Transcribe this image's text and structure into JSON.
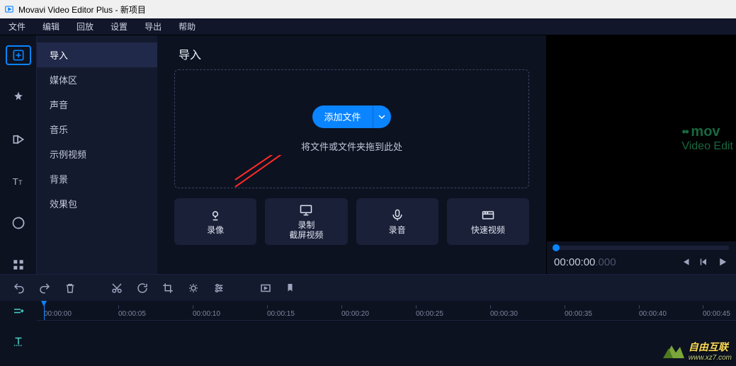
{
  "window": {
    "title": "Movavi Video Editor Plus - 新项目"
  },
  "menu": {
    "file": "文件",
    "edit": "编辑",
    "playback": "回放",
    "settings": "设置",
    "export": "导出",
    "help": "帮助"
  },
  "sidebar": {
    "items": [
      "导入",
      "媒体区",
      "声音",
      "音乐",
      "示例视频",
      "背景",
      "效果包"
    ]
  },
  "panel": {
    "title": "导入",
    "add_label": "添加文件",
    "drop_hint": "将文件或文件夹拖到此处",
    "capture": {
      "record": "录像",
      "screencap1": "录制",
      "screencap2": "截屏视频",
      "audio": "录音",
      "quickvideo": "快速视频"
    }
  },
  "preview": {
    "brand1": "mov",
    "brand2": "Video Edit",
    "time_main": "00:00:00",
    "time_ms": ".000"
  },
  "timeline": {
    "marks": [
      "00:00:00",
      "00:00:05",
      "00:00:10",
      "00:00:15",
      "00:00:20",
      "00:00:25",
      "00:00:30",
      "00:00:35",
      "00:00:40",
      "00:00:45"
    ]
  },
  "watermark": {
    "main": "自由互联",
    "sub": "www.xz7.com"
  }
}
